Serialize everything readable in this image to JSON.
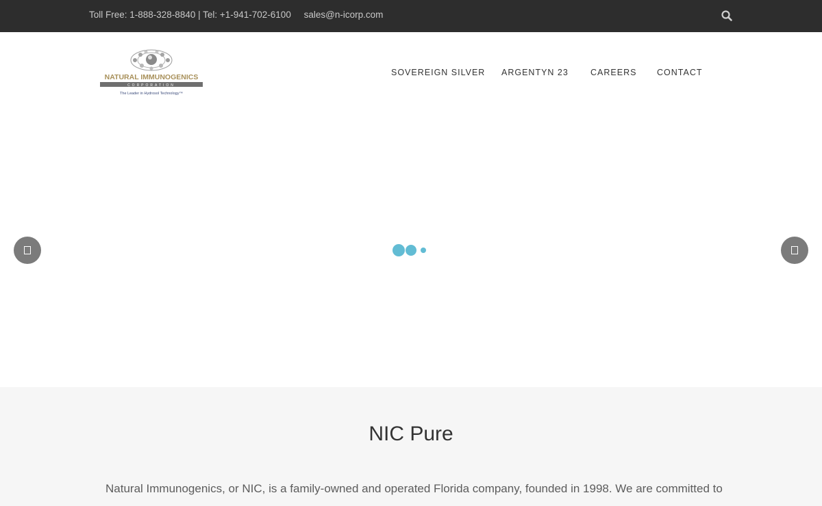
{
  "topbar": {
    "phone_line": "Toll Free: 1-888-328-8840 | Tel: +1-941-702-6100",
    "email": "sales@n-icorp.com",
    "search_icon": "search-icon"
  },
  "logo": {
    "name": "NATURAL IMMUNOGENICS",
    "subtitle": "CORPORATION",
    "tagline": "The Leader in Hydrosol Technology™"
  },
  "nav": {
    "items": [
      {
        "label": "SOVEREIGN SILVER"
      },
      {
        "label": "ARGENTYN 23"
      },
      {
        "label": "CAREERS"
      },
      {
        "label": "CONTACT"
      }
    ]
  },
  "slider": {
    "prev_icon": "chevron-left-icon",
    "next_icon": "chevron-right-icon",
    "loader_color": "#62bcd4"
  },
  "section": {
    "title": "NIC Pure",
    "text": "Natural Immunogenics, or NIC, is a family-owned and operated Florida company, founded in 1998. We are committed to"
  },
  "colors": {
    "topbar_bg": "#2d2d2d",
    "section_bg": "#f6f6f6",
    "logo_gold": "#a8905a",
    "logo_bar": "#6f6f6f"
  }
}
